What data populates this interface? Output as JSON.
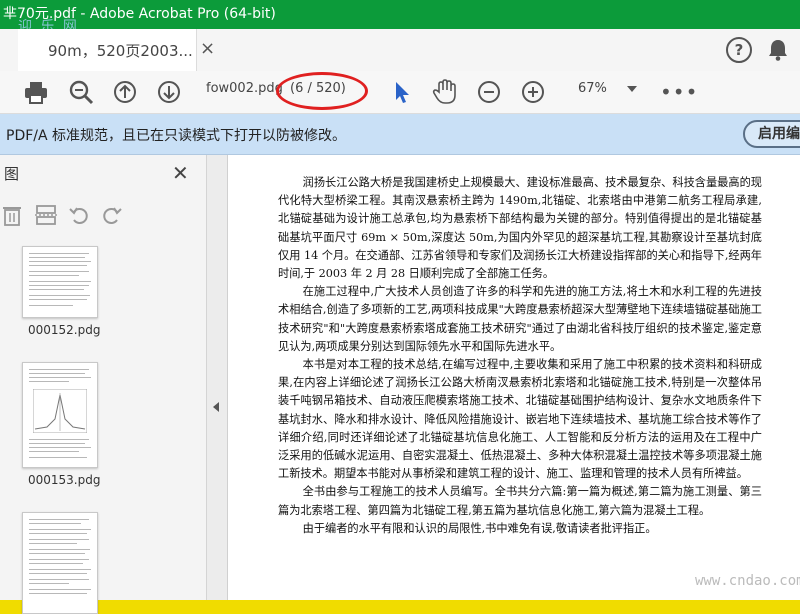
{
  "window": {
    "title": "芈70元.pdf - Adobe Acrobat Pro (64-bit)",
    "watermark_logo": "迎 乐 网"
  },
  "tab": {
    "label": "90m，520页2003...",
    "close": "×"
  },
  "help": {
    "label": "?"
  },
  "toolbar": {
    "filename": "fow002.pdg",
    "page_indicator": "(6 / 520)",
    "zoom": "67%",
    "more": "•••"
  },
  "notice": {
    "text": "PDF/A 标准规范，且已在只读模式下打开以防被修改。",
    "button": "启用编"
  },
  "sidebar": {
    "title": "图",
    "close": "✕",
    "thumbnails": [
      {
        "label": "000152.pdg"
      },
      {
        "label": "000153.pdg"
      },
      {
        "label": ""
      }
    ]
  },
  "document": {
    "paragraphs": [
      "润扬长江公路大桥是我国建桥史上规模最大、建设标准最高、技术最复杂、科技含量最高的现代化特大型桥梁工程。其南汊悬索桥主跨为 1490m,北锚碇、北索塔由中港第二航务工程局承建,北锚碇基础为设计施工总承包,均为悬索桥下部结构最为关键的部分。特别值得提出的是北锚碇基础基坑平面尺寸 69m × 50m,深度达 50m,为国内外罕见的超深基坑工程,其勘察设计至基坑封底仅用 14 个月。在交通部、江苏省领导和专家们及润扬长江大桥建设指挥部的关心和指导下,经两年时间,于 2003 年 2 月 28 日顺利完成了全部施工任务。",
      "在施工过程中,广大技术人员创造了许多的科学和先进的施工方法,将土木和水利工程的先进技术相结合,创造了多项新的工艺,两项科技成果\"大跨度悬索桥超深大型薄壁地下连续墙锚碇基础施工技术研究\"和\"大跨度悬索桥索塔成套施工技术研究\"通过了由湖北省科技厅组织的技术鉴定,鉴定意见认为,两项成果分别达到国际领先水平和国际先进水平。",
      "本书是对本工程的技术总结,在编写过程中,主要收集和采用了施工中积累的技术资料和科研成果,在内容上详细论述了润扬长江公路大桥南汊悬索桥北索塔和北锚碇施工技术,特别是一次整体吊装千吨钢吊箱技术、自动液压爬模索塔施工技术、北锚碇基础围护结构设计、复杂水文地质条件下基坑封水、降水和排水设计、降低风险措施设计、嵌岩地下连续墙技术、基坑施工综合技术等作了详细介绍,同时还详细论述了北锚碇基坑信息化施工、人工智能和反分析方法的运用及在工程中广泛采用的低碱水泥运用、自密实混凝土、低热混凝土、多种大体积混凝土温控技术等多项混凝土施工新技术。期望本书能对从事桥梁和建筑工程的设计、施工、监理和管理的技术人员有所裨益。",
      "全书由参与工程施工的技术人员编写。全书共分六篇:第一篇为概述,第二篇为施工测量、第三篇为北索塔工程、第四篇为北锚碇工程,第五篇为基坑信息化施工,第六篇为混凝土工程。",
      "由于编者的水平有限和认识的局限性,书中难免有误,敬请读者批评指正。"
    ],
    "watermark": "www.cndao.com"
  },
  "colors": {
    "titlebar": "#0c9b3a",
    "frame": "#f2e000",
    "notice_bg": "#c9e0f6",
    "highlight_ellipse": "#e02020",
    "cursor_icon": "#2a63c8"
  }
}
